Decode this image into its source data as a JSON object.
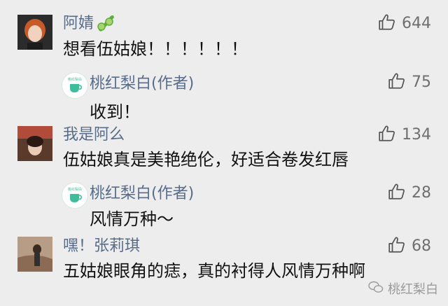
{
  "colors": {
    "accent": "#586c8a",
    "text": "#111111",
    "muted": "#6f6f6f",
    "leaf": "#3fbc9c",
    "cucumber": "#5fae3b"
  },
  "comments": [
    {
      "name": "阿婧",
      "text": "想看伍姑娘！！！！！！",
      "likes": "644"
    },
    {
      "name": "桃红梨白(作者)",
      "text": "收到！",
      "likes": "75",
      "avatar_caption": "桃红梨白"
    },
    {
      "name": "我是阿么",
      "text": "伍姑娘真是美艳绝伦，好适合卷发红唇",
      "likes": "134"
    },
    {
      "name": "桃红梨白(作者)",
      "text": "风情万种～",
      "likes": "28",
      "avatar_caption": "桃红梨白"
    },
    {
      "name": "嘿！张莉琪",
      "text": "五姑娘眼角的痣，真的衬得人风情万种啊",
      "likes": "68"
    }
  ],
  "watermark": "桃红梨白",
  "icons": [
    "thumbs-up-icon",
    "cucumber-icon",
    "teacup-logo-icon",
    "wechat-icon"
  ]
}
